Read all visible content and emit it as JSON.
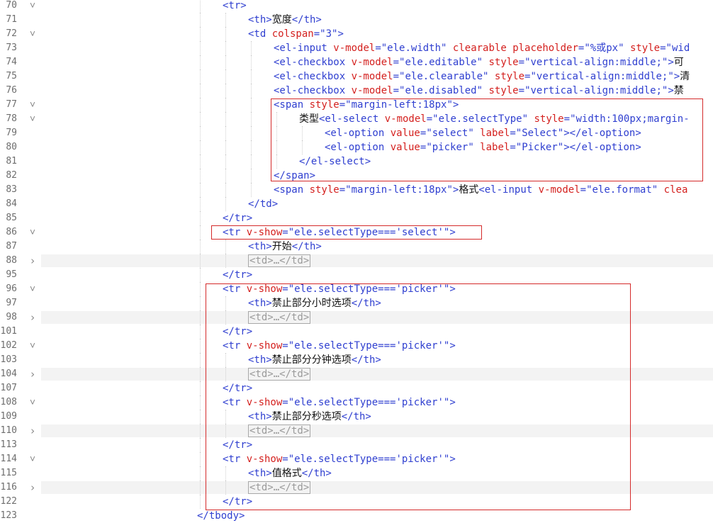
{
  "editor": {
    "lines": [
      {
        "num": "70",
        "fold": "open",
        "indent": 0,
        "code": [
          [
            "tg",
            "<tr>"
          ]
        ]
      },
      {
        "num": "71",
        "fold": "none",
        "indent": 1,
        "code": [
          [
            "tg",
            "<th>"
          ],
          [
            "tx",
            "宽度"
          ],
          [
            "tg",
            "</th>"
          ]
        ]
      },
      {
        "num": "72",
        "fold": "open",
        "indent": 1,
        "code": [
          [
            "tg",
            "<td "
          ],
          [
            "at",
            "colspan"
          ],
          [
            "tg",
            "="
          ],
          [
            "vl",
            "\"3\""
          ],
          [
            "tg",
            ">"
          ]
        ]
      },
      {
        "num": "73",
        "fold": "none",
        "indent": 2,
        "code": [
          [
            "tg",
            "<el-input "
          ],
          [
            "at",
            "v-model"
          ],
          [
            "tg",
            "="
          ],
          [
            "vl",
            "\"ele.width\" "
          ],
          [
            "at",
            "clearable "
          ],
          [
            "at",
            "placeholder"
          ],
          [
            "tg",
            "="
          ],
          [
            "vl",
            "\"%或px\" "
          ],
          [
            "at",
            "style"
          ],
          [
            "tg",
            "="
          ],
          [
            "vl",
            "\"wid"
          ]
        ]
      },
      {
        "num": "74",
        "fold": "none",
        "indent": 2,
        "code": [
          [
            "tg",
            "<el-checkbox "
          ],
          [
            "at",
            "v-model"
          ],
          [
            "tg",
            "="
          ],
          [
            "vl",
            "\"ele.editable\" "
          ],
          [
            "at",
            "style"
          ],
          [
            "tg",
            "="
          ],
          [
            "vl",
            "\"vertical-align:middle;\""
          ],
          [
            "tg",
            ">"
          ],
          [
            "tx",
            "可"
          ]
        ]
      },
      {
        "num": "75",
        "fold": "none",
        "indent": 2,
        "code": [
          [
            "tg",
            "<el-checkbox "
          ],
          [
            "at",
            "v-model"
          ],
          [
            "tg",
            "="
          ],
          [
            "vl",
            "\"ele.clearable\" "
          ],
          [
            "at",
            "style"
          ],
          [
            "tg",
            "="
          ],
          [
            "vl",
            "\"vertical-align:middle;\""
          ],
          [
            "tg",
            ">"
          ],
          [
            "tx",
            "清"
          ]
        ]
      },
      {
        "num": "76",
        "fold": "none",
        "indent": 2,
        "code": [
          [
            "tg",
            "<el-checkbox "
          ],
          [
            "at",
            "v-model"
          ],
          [
            "tg",
            "="
          ],
          [
            "vl",
            "\"ele.disabled\" "
          ],
          [
            "at",
            "style"
          ],
          [
            "tg",
            "="
          ],
          [
            "vl",
            "\"vertical-align:middle;\""
          ],
          [
            "tg",
            ">"
          ],
          [
            "tx",
            "禁"
          ]
        ]
      },
      {
        "num": "77",
        "fold": "open",
        "indent": 2,
        "code": [
          [
            "tg",
            "<span "
          ],
          [
            "at",
            "style"
          ],
          [
            "tg",
            "="
          ],
          [
            "vl",
            "\"margin-left:18px\""
          ],
          [
            "tg",
            ">"
          ]
        ]
      },
      {
        "num": "78",
        "fold": "open",
        "indent": 3,
        "code": [
          [
            "tx",
            "类型"
          ],
          [
            "tg",
            "<el-select "
          ],
          [
            "at",
            "v-model"
          ],
          [
            "tg",
            "="
          ],
          [
            "vl",
            "\"ele.selectType\" "
          ],
          [
            "at",
            "style"
          ],
          [
            "tg",
            "="
          ],
          [
            "vl",
            "\"width:100px;margin-"
          ]
        ]
      },
      {
        "num": "79",
        "fold": "none",
        "indent": 4,
        "code": [
          [
            "tg",
            "<el-option "
          ],
          [
            "at",
            "value"
          ],
          [
            "tg",
            "="
          ],
          [
            "vl",
            "\"select\" "
          ],
          [
            "at",
            "label"
          ],
          [
            "tg",
            "="
          ],
          [
            "vl",
            "\"Select\""
          ],
          [
            "tg",
            "></el-option>"
          ]
        ]
      },
      {
        "num": "80",
        "fold": "none",
        "indent": 4,
        "code": [
          [
            "tg",
            "<el-option "
          ],
          [
            "at",
            "value"
          ],
          [
            "tg",
            "="
          ],
          [
            "vl",
            "\"picker\" "
          ],
          [
            "at",
            "label"
          ],
          [
            "tg",
            "="
          ],
          [
            "vl",
            "\"Picker\""
          ],
          [
            "tg",
            "></el-option>"
          ]
        ]
      },
      {
        "num": "81",
        "fold": "none",
        "indent": 3,
        "code": [
          [
            "tg",
            "</el-select>"
          ]
        ]
      },
      {
        "num": "82",
        "fold": "none",
        "indent": 2,
        "code": [
          [
            "tg",
            "</span>"
          ]
        ]
      },
      {
        "num": "83",
        "fold": "none",
        "indent": 2,
        "code": [
          [
            "tg",
            "<span "
          ],
          [
            "at",
            "style"
          ],
          [
            "tg",
            "="
          ],
          [
            "vl",
            "\"margin-left:18px\""
          ],
          [
            "tg",
            ">"
          ],
          [
            "tx",
            "格式"
          ],
          [
            "tg",
            "<el-input "
          ],
          [
            "at",
            "v-model"
          ],
          [
            "tg",
            "="
          ],
          [
            "vl",
            "\"ele.format\" "
          ],
          [
            "at",
            "clea"
          ]
        ]
      },
      {
        "num": "84",
        "fold": "none",
        "indent": 1,
        "code": [
          [
            "tg",
            "</td>"
          ]
        ]
      },
      {
        "num": "85",
        "fold": "none",
        "indent": 0,
        "code": [
          [
            "tg",
            "</tr>"
          ]
        ]
      },
      {
        "num": "86",
        "fold": "open",
        "indent": 0,
        "code": [
          [
            "tg",
            "<tr "
          ],
          [
            "at",
            "v-show"
          ],
          [
            "tg",
            "="
          ],
          [
            "vl",
            "\"ele.selectType==='select'\""
          ],
          [
            "tg",
            ">"
          ]
        ]
      },
      {
        "num": "87",
        "fold": "none",
        "indent": 1,
        "code": [
          [
            "tg",
            "<th>"
          ],
          [
            "tx",
            "开始"
          ],
          [
            "tg",
            "</th>"
          ]
        ]
      },
      {
        "num": "88",
        "fold": "closed",
        "indent": 1,
        "code": [
          [
            "fb",
            "<td>…</td>"
          ]
        ]
      },
      {
        "num": "95",
        "fold": "none",
        "indent": 0,
        "code": [
          [
            "tg",
            "</tr>"
          ]
        ]
      },
      {
        "num": "96",
        "fold": "open",
        "indent": 0,
        "code": [
          [
            "tg",
            "<tr "
          ],
          [
            "at",
            "v-show"
          ],
          [
            "tg",
            "="
          ],
          [
            "vl",
            "\"ele.selectType==='picker'\""
          ],
          [
            "tg",
            ">"
          ]
        ]
      },
      {
        "num": "97",
        "fold": "none",
        "indent": 1,
        "code": [
          [
            "tg",
            "<th>"
          ],
          [
            "tx",
            "禁止部分小时选项"
          ],
          [
            "tg",
            "</th>"
          ]
        ]
      },
      {
        "num": "98",
        "fold": "closed",
        "indent": 1,
        "code": [
          [
            "fb",
            "<td>…</td>"
          ]
        ]
      },
      {
        "num": "101",
        "fold": "none",
        "indent": 0,
        "code": [
          [
            "tg",
            "</tr>"
          ]
        ]
      },
      {
        "num": "102",
        "fold": "open",
        "indent": 0,
        "code": [
          [
            "tg",
            "<tr "
          ],
          [
            "at",
            "v-show"
          ],
          [
            "tg",
            "="
          ],
          [
            "vl",
            "\"ele.selectType==='picker'\""
          ],
          [
            "tg",
            ">"
          ]
        ]
      },
      {
        "num": "103",
        "fold": "none",
        "indent": 1,
        "code": [
          [
            "tg",
            "<th>"
          ],
          [
            "tx",
            "禁止部分分钟选项"
          ],
          [
            "tg",
            "</th>"
          ]
        ]
      },
      {
        "num": "104",
        "fold": "closed",
        "indent": 1,
        "code": [
          [
            "fb",
            "<td>…</td>"
          ]
        ]
      },
      {
        "num": "107",
        "fold": "none",
        "indent": 0,
        "code": [
          [
            "tg",
            "</tr>"
          ]
        ]
      },
      {
        "num": "108",
        "fold": "open",
        "indent": 0,
        "code": [
          [
            "tg",
            "<tr "
          ],
          [
            "at",
            "v-show"
          ],
          [
            "tg",
            "="
          ],
          [
            "vl",
            "\"ele.selectType==='picker'\""
          ],
          [
            "tg",
            ">"
          ]
        ]
      },
      {
        "num": "109",
        "fold": "none",
        "indent": 1,
        "code": [
          [
            "tg",
            "<th>"
          ],
          [
            "tx",
            "禁止部分秒选项"
          ],
          [
            "tg",
            "</th>"
          ]
        ]
      },
      {
        "num": "110",
        "fold": "closed",
        "indent": 1,
        "code": [
          [
            "fb",
            "<td>…</td>"
          ]
        ]
      },
      {
        "num": "113",
        "fold": "none",
        "indent": 0,
        "code": [
          [
            "tg",
            "</tr>"
          ]
        ]
      },
      {
        "num": "114",
        "fold": "open",
        "indent": 0,
        "code": [
          [
            "tg",
            "<tr "
          ],
          [
            "at",
            "v-show"
          ],
          [
            "tg",
            "="
          ],
          [
            "vl",
            "\"ele.selectType==='picker'\""
          ],
          [
            "tg",
            ">"
          ]
        ]
      },
      {
        "num": "115",
        "fold": "none",
        "indent": 1,
        "code": [
          [
            "tg",
            "<th>"
          ],
          [
            "tx",
            "值格式"
          ],
          [
            "tg",
            "</th>"
          ]
        ]
      },
      {
        "num": "116",
        "fold": "closed",
        "indent": 1,
        "code": [
          [
            "fb",
            "<td>…</td>"
          ]
        ]
      },
      {
        "num": "122",
        "fold": "none",
        "indent": 0,
        "code": [
          [
            "tg",
            "</tr>"
          ]
        ]
      },
      {
        "num": "123",
        "fold": "none",
        "indent": -1,
        "code": [
          [
            "tg",
            "</tbody>"
          ]
        ]
      }
    ],
    "colors": {
      "tag": "#2f3fd0",
      "attribute": "#d4201e",
      "value": "#2f3fd0",
      "text": "#111111",
      "highlight_box": "#d42a2a"
    },
    "icons": {
      "open": "chevron-down-icon",
      "closed": "chevron-right-icon"
    }
  }
}
